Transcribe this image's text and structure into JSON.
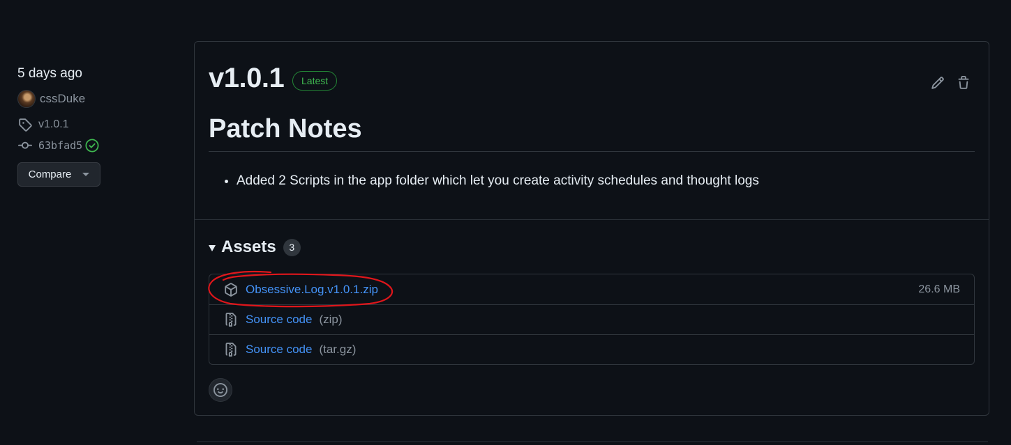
{
  "meta": {
    "date": "5 days ago",
    "author": "cssDuke",
    "tag": "v1.0.1",
    "commit": "63bfad5",
    "compare_label": "Compare"
  },
  "release": {
    "version": "v1.0.1",
    "badge": "Latest",
    "notes_title": "Patch Notes",
    "notes": [
      "Added 2 Scripts in the app folder which let you create activity schedules and thought logs"
    ]
  },
  "assets": {
    "title": "Assets",
    "count": "3",
    "items": [
      {
        "name": "Obsessive.Log.v1.0.1.zip",
        "suffix": "",
        "size": "26.6 MB",
        "icon": "package-icon"
      },
      {
        "name": "Source code",
        "suffix": "(zip)",
        "size": "",
        "icon": "file-zip-icon"
      },
      {
        "name": "Source code",
        "suffix": "(tar.gz)",
        "size": "",
        "icon": "file-zip-icon"
      }
    ]
  },
  "colors": {
    "background": "#0d1117",
    "border": "#30363d",
    "link": "#4493f8",
    "success": "#3fb950",
    "annotation": "#e0161b"
  }
}
